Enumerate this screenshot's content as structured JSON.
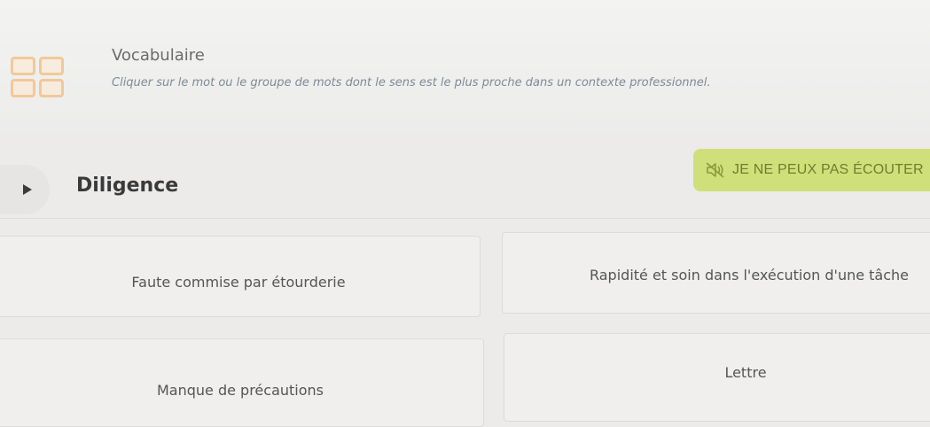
{
  "header": {
    "title": "Vocabulaire",
    "instruction": "Cliquer sur le mot ou le groupe de mots dont le sens est le plus proche dans un contexte professionnel.",
    "icon": "grid-icon"
  },
  "exercise": {
    "word": "Diligence",
    "play_icon": "play-icon",
    "cant_listen_label": "JE NE PEUX PAS ÉCOUTER",
    "cant_listen_icon": "speaker-muted-icon",
    "options": [
      "Faute commise par étourderie",
      "Rapidité et soin dans l'exécution d'une tâche",
      "Manque de précautions",
      "Lettre"
    ]
  },
  "colors": {
    "accent_button": "#cfe07a",
    "accent_button_text": "#6f7e2d",
    "icon_orange": "#f2c89a",
    "instruction_text": "#7f8a96"
  }
}
